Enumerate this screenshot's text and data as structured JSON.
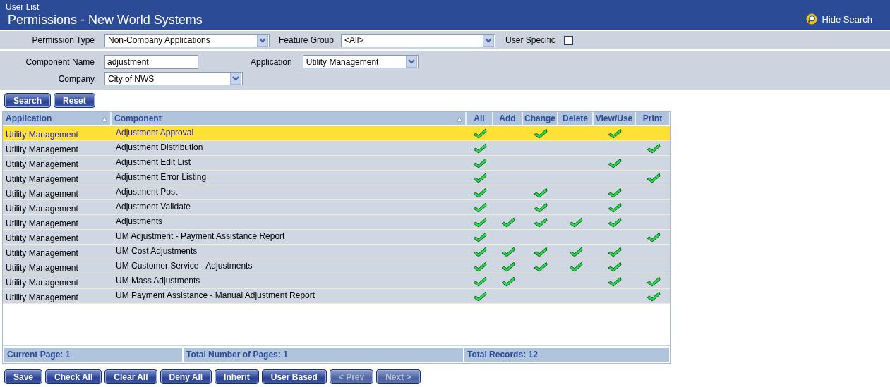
{
  "header": {
    "breadcrumb": "User List",
    "title": "Permissions - New World Systems",
    "hide_search": "Hide Search"
  },
  "filters": {
    "permission_type": {
      "label": "Permission Type",
      "value": "Non-Company Applications"
    },
    "feature_group": {
      "label": "Feature Group",
      "value": "<All>"
    },
    "user_specific": {
      "label": "User Specific",
      "checked": false
    },
    "component_name": {
      "label": "Component Name",
      "value": "adjustment"
    },
    "application": {
      "label": "Application",
      "value": "Utility Management"
    },
    "company": {
      "label": "Company",
      "value": "City of NWS"
    }
  },
  "search_buttons": [
    {
      "label": "Search",
      "disabled": false
    },
    {
      "label": "Reset",
      "disabled": false
    }
  ],
  "table": {
    "columns": [
      {
        "label": "Application",
        "sortable": true
      },
      {
        "label": "Component",
        "sortable": true
      },
      {
        "label": "All",
        "sortable": false
      },
      {
        "label": "Add",
        "sortable": false
      },
      {
        "label": "Change",
        "sortable": false
      },
      {
        "label": "Delete",
        "sortable": false
      },
      {
        "label": "View/Use",
        "sortable": false
      },
      {
        "label": "Print",
        "sortable": false
      }
    ],
    "rows": [
      {
        "application": "Utility Management",
        "component": "Adjustment Approval",
        "selected": true,
        "permissions": [
          true,
          false,
          true,
          false,
          true,
          false
        ]
      },
      {
        "application": "Utility Management",
        "component": "Adjustment Distribution",
        "selected": false,
        "permissions": [
          true,
          false,
          false,
          false,
          false,
          true
        ]
      },
      {
        "application": "Utility Management",
        "component": "Adjustment Edit List",
        "selected": false,
        "permissions": [
          true,
          false,
          false,
          false,
          true,
          false
        ]
      },
      {
        "application": "Utility Management",
        "component": "Adjustment Error Listing",
        "selected": false,
        "permissions": [
          true,
          false,
          false,
          false,
          false,
          true
        ]
      },
      {
        "application": "Utility Management",
        "component": "Adjustment Post",
        "selected": false,
        "permissions": [
          true,
          false,
          true,
          false,
          true,
          false
        ]
      },
      {
        "application": "Utility Management",
        "component": "Adjustment Validate",
        "selected": false,
        "permissions": [
          true,
          false,
          true,
          false,
          true,
          false
        ]
      },
      {
        "application": "Utility Management",
        "component": "Adjustments",
        "selected": false,
        "permissions": [
          true,
          true,
          true,
          true,
          true,
          false
        ]
      },
      {
        "application": "Utility Management",
        "component": "UM Adjustment - Payment Assistance Report",
        "selected": false,
        "permissions": [
          true,
          false,
          false,
          false,
          false,
          true
        ]
      },
      {
        "application": "Utility Management",
        "component": "UM Cost Adjustments",
        "selected": false,
        "permissions": [
          true,
          true,
          true,
          true,
          true,
          false
        ]
      },
      {
        "application": "Utility Management",
        "component": "UM Customer Service - Adjustments",
        "selected": false,
        "permissions": [
          true,
          true,
          true,
          true,
          true,
          false
        ]
      },
      {
        "application": "Utility Management",
        "component": "UM Mass Adjustments",
        "selected": false,
        "permissions": [
          true,
          true,
          false,
          false,
          true,
          true
        ]
      },
      {
        "application": "Utility Management",
        "component": "UM Payment Assistance - Manual Adjustment Report",
        "selected": false,
        "permissions": [
          true,
          false,
          false,
          false,
          false,
          true
        ]
      }
    ],
    "footer": [
      "Current Page: 1",
      "Total Number of Pages: 1",
      "Total Records: 12"
    ]
  },
  "action_buttons": [
    {
      "label": "Save",
      "disabled": false
    },
    {
      "label": "Check All",
      "disabled": false
    },
    {
      "label": "Clear All",
      "disabled": false
    },
    {
      "label": "Deny All",
      "disabled": false
    },
    {
      "label": "Inherit",
      "disabled": false
    },
    {
      "label": "User Based",
      "disabled": false
    },
    {
      "label": "< Prev",
      "disabled": true
    },
    {
      "label": "Next >",
      "disabled": true
    }
  ]
}
